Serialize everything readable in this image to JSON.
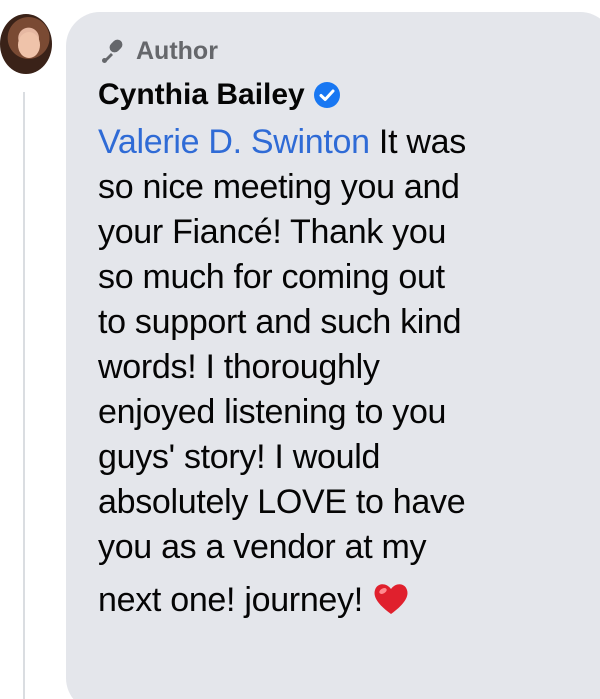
{
  "comment": {
    "author_badge_label": "Author",
    "author_name": "Cynthia Bailey",
    "mention": "Valerie D. Swinton",
    "lines": [
      "It was",
      "so nice meeting you and",
      "your Fiancé! Thank you",
      "so much for coming out",
      "to support and such kind",
      "words! I thoroughly",
      "enjoyed listening to you",
      "guys' story! I would",
      "absolutely LOVE to have",
      "you as a vendor at my",
      "next one! journey!"
    ]
  },
  "icons": {
    "badge": "microphone-icon",
    "verified": "verified-badge-icon",
    "reaction": "red-heart-icon"
  },
  "colors": {
    "bubble": "#e4e6eb",
    "mention": "#2f6bd6",
    "verified": "#1877f2",
    "heart": "#e0202d",
    "muted": "#65676b"
  }
}
